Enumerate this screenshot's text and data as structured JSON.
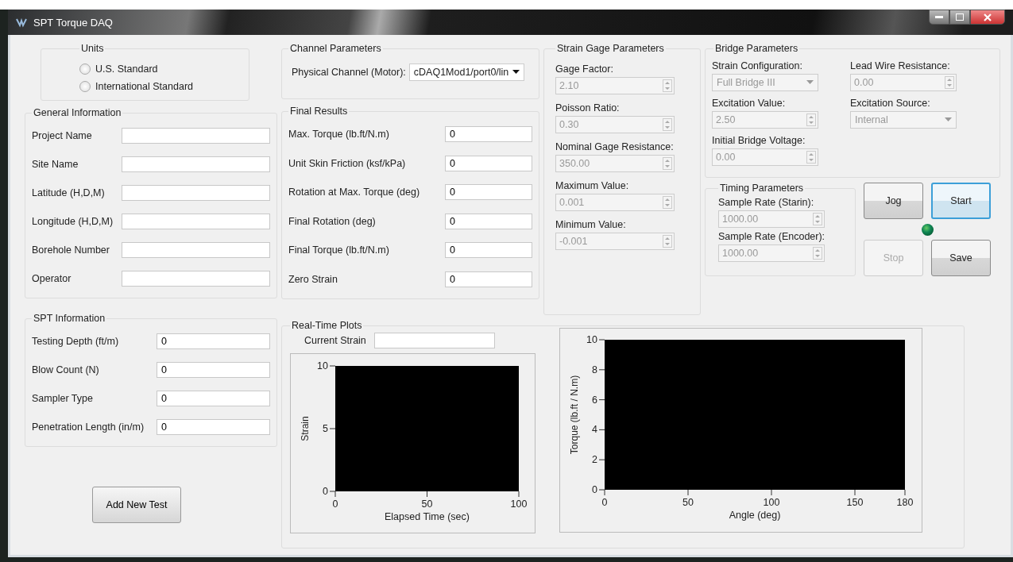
{
  "window": {
    "title": "SPT Torque DAQ"
  },
  "units": {
    "title": "Units",
    "options": [
      {
        "label": "U.S. Standard",
        "selected": false
      },
      {
        "label": "International Standard",
        "selected": false
      }
    ]
  },
  "general_information": {
    "title": "General Information",
    "fields": [
      {
        "label": "Project Name"
      },
      {
        "label": "Site Name"
      },
      {
        "label": "Latitude (H,D,M)"
      },
      {
        "label": "Longitude (H,D,M)"
      },
      {
        "label": "Borehole Number"
      },
      {
        "label": "Operator"
      }
    ]
  },
  "spt_information": {
    "title": "SPT Information",
    "fields": [
      {
        "label": "Testing Depth (ft/m)",
        "value": "0"
      },
      {
        "label": "Blow Count (N)",
        "value": "0"
      },
      {
        "label": "Sampler Type",
        "value": "0"
      },
      {
        "label": "Penetration Length (in/m)",
        "value": "0"
      }
    ]
  },
  "add_button": {
    "label": "Add New Test"
  },
  "channel_parameters": {
    "title": "Channel Parameters",
    "label": "Physical Channel (Motor):",
    "value": "cDAQ1Mod1/port0/lin",
    "disabled": false
  },
  "final_results": {
    "title": "Final Results",
    "fields": [
      {
        "label": "Max. Torque (lb.ft/N.m)",
        "value": "0"
      },
      {
        "label": "Unit Skin Friction (ksf/kPa)",
        "value": "0"
      },
      {
        "label": "Rotation at Max. Torque (deg)",
        "value": "0"
      },
      {
        "label": "Final Rotation (deg)",
        "value": "0"
      },
      {
        "label": "Final Torque (lb.ft/N.m)",
        "value": "0"
      },
      {
        "label": "Zero Strain",
        "value": "0"
      }
    ]
  },
  "strain_gage_parameters": {
    "title": "Strain Gage Parameters",
    "fields": [
      {
        "label": "Gage Factor:",
        "value": "2.10",
        "kind": "spin",
        "disabled": true
      },
      {
        "label": "Poisson Ratio:",
        "value": "0.30",
        "kind": "spin",
        "disabled": true
      },
      {
        "label": "Nominal Gage Resistance:",
        "value": "350.00",
        "kind": "spin",
        "disabled": true
      },
      {
        "label": "Maximum Value:",
        "value": "0.001",
        "kind": "spin",
        "disabled": true
      },
      {
        "label": "Minimum Value:",
        "value": "-0.001",
        "kind": "spin",
        "disabled": true
      }
    ]
  },
  "bridge_parameters": {
    "title": "Bridge Parameters",
    "fields": [
      {
        "label": "Strain Configuration:",
        "value": "Full Bridge III",
        "kind": "dropdown",
        "disabled": true
      },
      {
        "label": "Lead Wire Resistance:",
        "value": "0.00",
        "kind": "spin",
        "disabled": true
      },
      {
        "label": "Excitation Value:",
        "value": "2.50",
        "kind": "spin",
        "disabled": true
      },
      {
        "label": "Excitation Source:",
        "value": "Internal",
        "kind": "dropdown",
        "disabled": true
      },
      {
        "label": "Initial Bridge Voltage:",
        "value": "0.00",
        "kind": "spin",
        "disabled": true
      }
    ]
  },
  "timing_parameters": {
    "title": "Timing Parameters",
    "fields": [
      {
        "label": "Sample Rate (Starin):",
        "value": "1000.00",
        "kind": "spin",
        "disabled": true
      },
      {
        "label": "Sample Rate (Encoder):",
        "value": "1000.00",
        "kind": "spin",
        "disabled": true
      }
    ]
  },
  "buttons": [
    {
      "label": "Jog",
      "disabled": false,
      "focused": false
    },
    {
      "label": "Start",
      "disabled": false,
      "focused": true
    },
    {
      "label": "Stop",
      "disabled": true,
      "focused": false
    },
    {
      "label": "Save",
      "disabled": false,
      "focused": false
    }
  ],
  "indicator": {
    "on": true
  },
  "real_time_plots": {
    "title": "Real-Time Plots",
    "current_strain": {
      "label": "Current Strain"
    },
    "charts": [
      {
        "chart_data": {
          "type": "line",
          "xlabel": "Elapsed Time (sec)",
          "ylabel": "Strain",
          "xlim": [
            0,
            100
          ],
          "ylim": [
            0,
            10
          ],
          "xticks": [
            0,
            50,
            100
          ],
          "yticks": [
            0,
            5,
            10
          ]
        }
      },
      {
        "chart_data": {
          "type": "line",
          "xlabel": "Angle (deg)",
          "ylabel": "Torque (lb.ft / N.m)",
          "xlim": [
            0,
            180
          ],
          "ylim": [
            0,
            10
          ],
          "xticks": [
            0,
            50,
            100,
            150,
            180
          ],
          "yticks": [
            0,
            2,
            4,
            6,
            8,
            10
          ]
        }
      }
    ]
  }
}
